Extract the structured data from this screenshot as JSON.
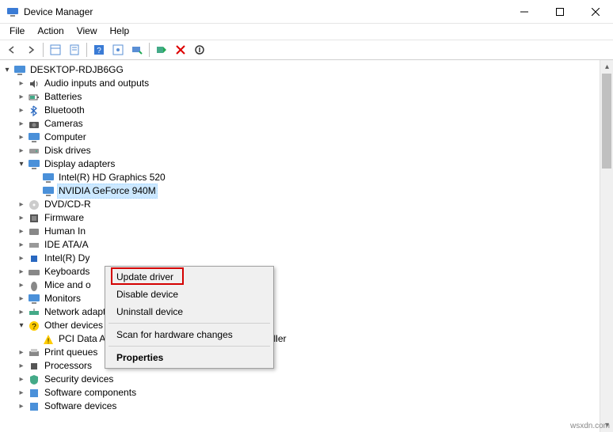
{
  "window": {
    "title": "Device Manager"
  },
  "menubar": {
    "file": "File",
    "action": "Action",
    "view": "View",
    "help": "Help"
  },
  "tree": {
    "root": "DESKTOP-RDJB6GG",
    "audio": "Audio inputs and outputs",
    "batteries": "Batteries",
    "bluetooth": "Bluetooth",
    "cameras": "Cameras",
    "computer": "Computer",
    "diskdrives": "Disk drives",
    "display": "Display adapters",
    "display_intel": "Intel(R) HD Graphics 520",
    "display_nvidia": "NVIDIA GeForce 940M",
    "dvd": "DVD/CD-R",
    "firmware": "Firmware",
    "hid": "Human In",
    "ide": "IDE ATA/A",
    "intelr": "Intel(R) Dy",
    "keyboards": "Keyboards",
    "mice": "Mice and o",
    "monitors": "Monitors",
    "network": "Network adapters",
    "other": "Other devices",
    "other_pci": "PCI Data Acquisition and Signal Processing Controller",
    "printq": "Print queues",
    "processors": "Processors",
    "security": "Security devices",
    "swcomp": "Software components",
    "swdev": "Software devices"
  },
  "context_menu": {
    "update": "Update driver",
    "disable": "Disable device",
    "uninstall": "Uninstall device",
    "scan": "Scan for hardware changes",
    "properties": "Properties"
  },
  "watermark": "wsxdn.com"
}
